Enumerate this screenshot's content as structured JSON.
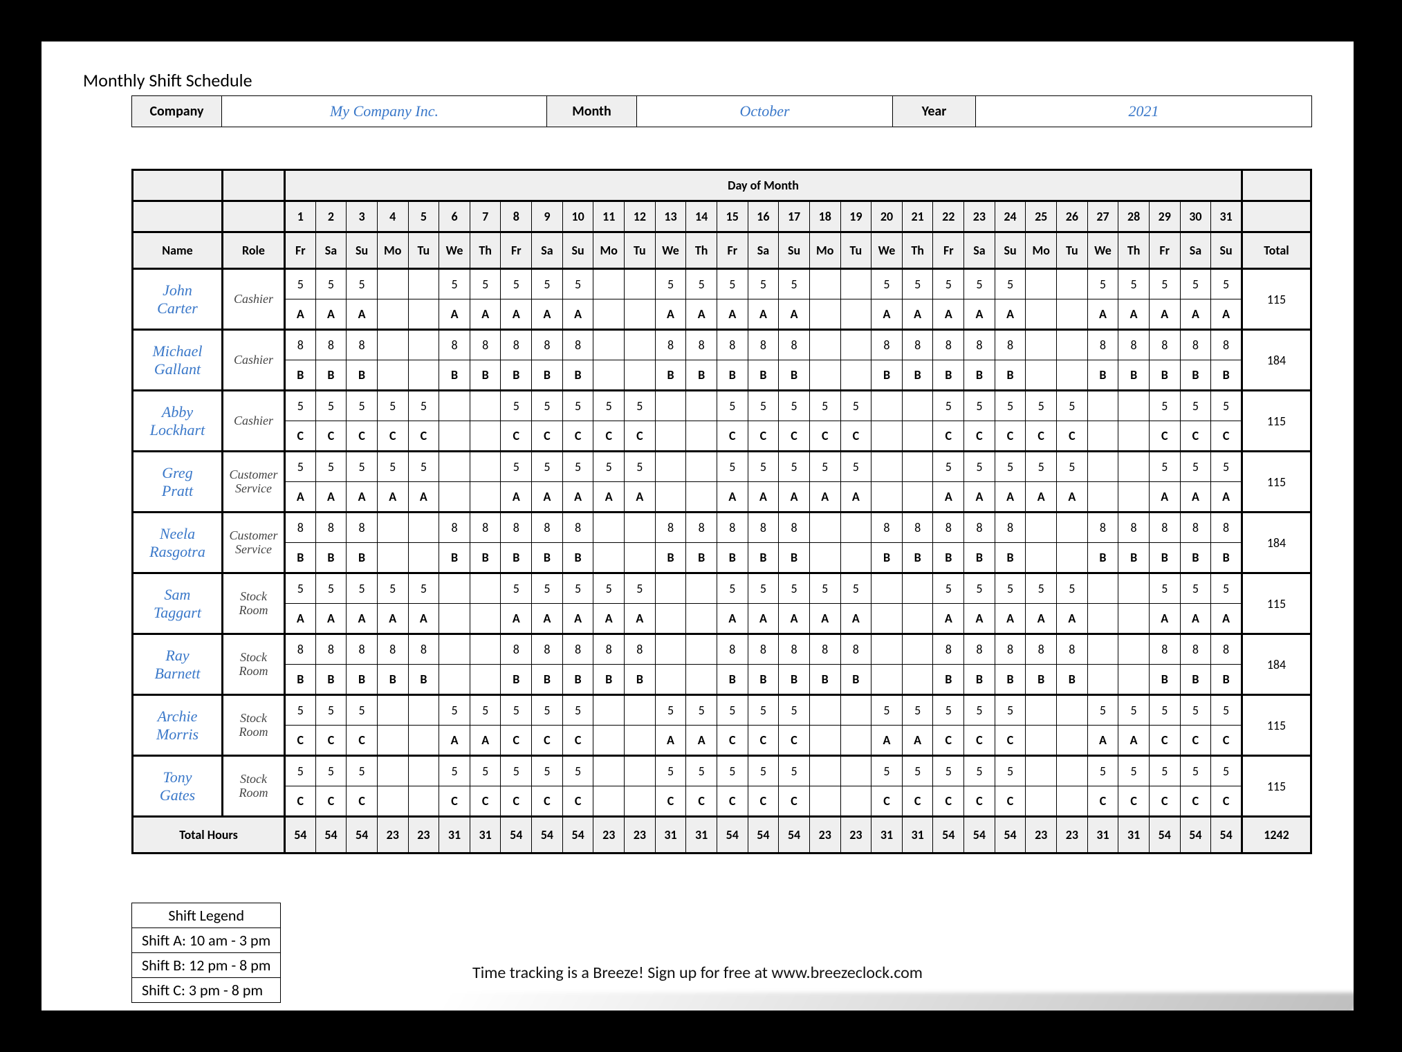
{
  "title": "Monthly Shift Schedule",
  "meta": {
    "company_label": "Company",
    "company_value": "My Company Inc.",
    "month_label": "Month",
    "month_value": "October",
    "year_label": "Year",
    "year_value": "2021"
  },
  "headers": {
    "day_of_month": "Day of Month",
    "name": "Name",
    "role": "Role",
    "total": "Total",
    "total_hours": "Total Hours"
  },
  "days": [
    "1",
    "2",
    "3",
    "4",
    "5",
    "6",
    "7",
    "8",
    "9",
    "10",
    "11",
    "12",
    "13",
    "14",
    "15",
    "16",
    "17",
    "18",
    "19",
    "20",
    "21",
    "22",
    "23",
    "24",
    "25",
    "26",
    "27",
    "28",
    "29",
    "30",
    "31"
  ],
  "weekdays": [
    "Fr",
    "Sa",
    "Su",
    "Mo",
    "Tu",
    "We",
    "Th",
    "Fr",
    "Sa",
    "Su",
    "Mo",
    "Tu",
    "We",
    "Th",
    "Fr",
    "Sa",
    "Su",
    "Mo",
    "Tu",
    "We",
    "Th",
    "Fr",
    "Sa",
    "Su",
    "Mo",
    "Tu",
    "We",
    "Th",
    "Fr",
    "Sa",
    "Su"
  ],
  "employees": [
    {
      "name": "John Carter",
      "role": "Cashier",
      "hours": [
        "5",
        "5",
        "5",
        "",
        "",
        "5",
        "5",
        "5",
        "5",
        "5",
        "",
        "",
        "5",
        "5",
        "5",
        "5",
        "5",
        "",
        "",
        "5",
        "5",
        "5",
        "5",
        "5",
        "",
        "",
        "5",
        "5",
        "5",
        "5",
        "5"
      ],
      "shifts": [
        "A",
        "A",
        "A",
        "",
        "",
        "A",
        "A",
        "A",
        "A",
        "A",
        "",
        "",
        "A",
        "A",
        "A",
        "A",
        "A",
        "",
        "",
        "A",
        "A",
        "A",
        "A",
        "A",
        "",
        "",
        "A",
        "A",
        "A",
        "A",
        "A"
      ],
      "total": "115"
    },
    {
      "name": "Michael Gallant",
      "role": "Cashier",
      "hours": [
        "8",
        "8",
        "8",
        "",
        "",
        "8",
        "8",
        "8",
        "8",
        "8",
        "",
        "",
        "8",
        "8",
        "8",
        "8",
        "8",
        "",
        "",
        "8",
        "8",
        "8",
        "8",
        "8",
        "",
        "",
        "8",
        "8",
        "8",
        "8",
        "8"
      ],
      "shifts": [
        "B",
        "B",
        "B",
        "",
        "",
        "B",
        "B",
        "B",
        "B",
        "B",
        "",
        "",
        "B",
        "B",
        "B",
        "B",
        "B",
        "",
        "",
        "B",
        "B",
        "B",
        "B",
        "B",
        "",
        "",
        "B",
        "B",
        "B",
        "B",
        "B"
      ],
      "total": "184"
    },
    {
      "name": "Abby Lockhart",
      "role": "Cashier",
      "hours": [
        "5",
        "5",
        "5",
        "5",
        "5",
        "",
        "",
        "5",
        "5",
        "5",
        "5",
        "5",
        "",
        "",
        "5",
        "5",
        "5",
        "5",
        "5",
        "",
        "",
        "5",
        "5",
        "5",
        "5",
        "5",
        "",
        "",
        "5",
        "5",
        "5"
      ],
      "shifts": [
        "C",
        "C",
        "C",
        "C",
        "C",
        "",
        "",
        "C",
        "C",
        "C",
        "C",
        "C",
        "",
        "",
        "C",
        "C",
        "C",
        "C",
        "C",
        "",
        "",
        "C",
        "C",
        "C",
        "C",
        "C",
        "",
        "",
        "C",
        "C",
        "C"
      ],
      "total": "115"
    },
    {
      "name": "Greg Pratt",
      "role": "Customer Service",
      "hours": [
        "5",
        "5",
        "5",
        "5",
        "5",
        "",
        "",
        "5",
        "5",
        "5",
        "5",
        "5",
        "",
        "",
        "5",
        "5",
        "5",
        "5",
        "5",
        "",
        "",
        "5",
        "5",
        "5",
        "5",
        "5",
        "",
        "",
        "5",
        "5",
        "5"
      ],
      "shifts": [
        "A",
        "A",
        "A",
        "A",
        "A",
        "",
        "",
        "A",
        "A",
        "A",
        "A",
        "A",
        "",
        "",
        "A",
        "A",
        "A",
        "A",
        "A",
        "",
        "",
        "A",
        "A",
        "A",
        "A",
        "A",
        "",
        "",
        "A",
        "A",
        "A"
      ],
      "total": "115"
    },
    {
      "name": "Neela Rasgotra",
      "role": "Customer Service",
      "hours": [
        "8",
        "8",
        "8",
        "",
        "",
        "8",
        "8",
        "8",
        "8",
        "8",
        "",
        "",
        "8",
        "8",
        "8",
        "8",
        "8",
        "",
        "",
        "8",
        "8",
        "8",
        "8",
        "8",
        "",
        "",
        "8",
        "8",
        "8",
        "8",
        "8"
      ],
      "shifts": [
        "B",
        "B",
        "B",
        "",
        "",
        "B",
        "B",
        "B",
        "B",
        "B",
        "",
        "",
        "B",
        "B",
        "B",
        "B",
        "B",
        "",
        "",
        "B",
        "B",
        "B",
        "B",
        "B",
        "",
        "",
        "B",
        "B",
        "B",
        "B",
        "B"
      ],
      "total": "184"
    },
    {
      "name": "Sam Taggart",
      "role": "Stock Room",
      "hours": [
        "5",
        "5",
        "5",
        "5",
        "5",
        "",
        "",
        "5",
        "5",
        "5",
        "5",
        "5",
        "",
        "",
        "5",
        "5",
        "5",
        "5",
        "5",
        "",
        "",
        "5",
        "5",
        "5",
        "5",
        "5",
        "",
        "",
        "5",
        "5",
        "5"
      ],
      "shifts": [
        "A",
        "A",
        "A",
        "A",
        "A",
        "",
        "",
        "A",
        "A",
        "A",
        "A",
        "A",
        "",
        "",
        "A",
        "A",
        "A",
        "A",
        "A",
        "",
        "",
        "A",
        "A",
        "A",
        "A",
        "A",
        "",
        "",
        "A",
        "A",
        "A"
      ],
      "total": "115"
    },
    {
      "name": "Ray Barnett",
      "role": "Stock Room",
      "hours": [
        "8",
        "8",
        "8",
        "8",
        "8",
        "",
        "",
        "8",
        "8",
        "8",
        "8",
        "8",
        "",
        "",
        "8",
        "8",
        "8",
        "8",
        "8",
        "",
        "",
        "8",
        "8",
        "8",
        "8",
        "8",
        "",
        "",
        "8",
        "8",
        "8"
      ],
      "shifts": [
        "B",
        "B",
        "B",
        "B",
        "B",
        "",
        "",
        "B",
        "B",
        "B",
        "B",
        "B",
        "",
        "",
        "B",
        "B",
        "B",
        "B",
        "B",
        "",
        "",
        "B",
        "B",
        "B",
        "B",
        "B",
        "",
        "",
        "B",
        "B",
        "B"
      ],
      "total": "184"
    },
    {
      "name": "Archie Morris",
      "role": "Stock Room",
      "hours": [
        "5",
        "5",
        "5",
        "",
        "",
        "5",
        "5",
        "5",
        "5",
        "5",
        "",
        "",
        "5",
        "5",
        "5",
        "5",
        "5",
        "",
        "",
        "5",
        "5",
        "5",
        "5",
        "5",
        "",
        "",
        "5",
        "5",
        "5",
        "5",
        "5"
      ],
      "shifts": [
        "C",
        "C",
        "C",
        "",
        "",
        "A",
        "A",
        "C",
        "C",
        "C",
        "",
        "",
        "A",
        "A",
        "C",
        "C",
        "C",
        "",
        "",
        "A",
        "A",
        "C",
        "C",
        "C",
        "",
        "",
        "A",
        "A",
        "C",
        "C",
        "C"
      ],
      "total": "115"
    },
    {
      "name": "Tony Gates",
      "role": "Stock Room",
      "hours": [
        "5",
        "5",
        "5",
        "",
        "",
        "5",
        "5",
        "5",
        "5",
        "5",
        "",
        "",
        "5",
        "5",
        "5",
        "5",
        "5",
        "",
        "",
        "5",
        "5",
        "5",
        "5",
        "5",
        "",
        "",
        "5",
        "5",
        "5",
        "5",
        "5"
      ],
      "shifts": [
        "C",
        "C",
        "C",
        "",
        "",
        "C",
        "C",
        "C",
        "C",
        "C",
        "",
        "",
        "C",
        "C",
        "C",
        "C",
        "C",
        "",
        "",
        "C",
        "C",
        "C",
        "C",
        "C",
        "",
        "",
        "C",
        "C",
        "C",
        "C",
        "C"
      ],
      "total": "115"
    }
  ],
  "column_totals": [
    "54",
    "54",
    "54",
    "23",
    "23",
    "31",
    "31",
    "54",
    "54",
    "54",
    "23",
    "23",
    "31",
    "31",
    "54",
    "54",
    "54",
    "23",
    "23",
    "31",
    "31",
    "54",
    "54",
    "54",
    "23",
    "23",
    "31",
    "31",
    "54",
    "54",
    "54"
  ],
  "grand_total": "1242",
  "legend": {
    "title": "Shift Legend",
    "rows": [
      "Shift A: 10 am - 3 pm",
      "Shift B: 12 pm - 8 pm",
      "Shift C: 3 pm - 8 pm"
    ]
  },
  "footer": "Time tracking is a Breeze! Sign up for free at www.breezeclock.com"
}
